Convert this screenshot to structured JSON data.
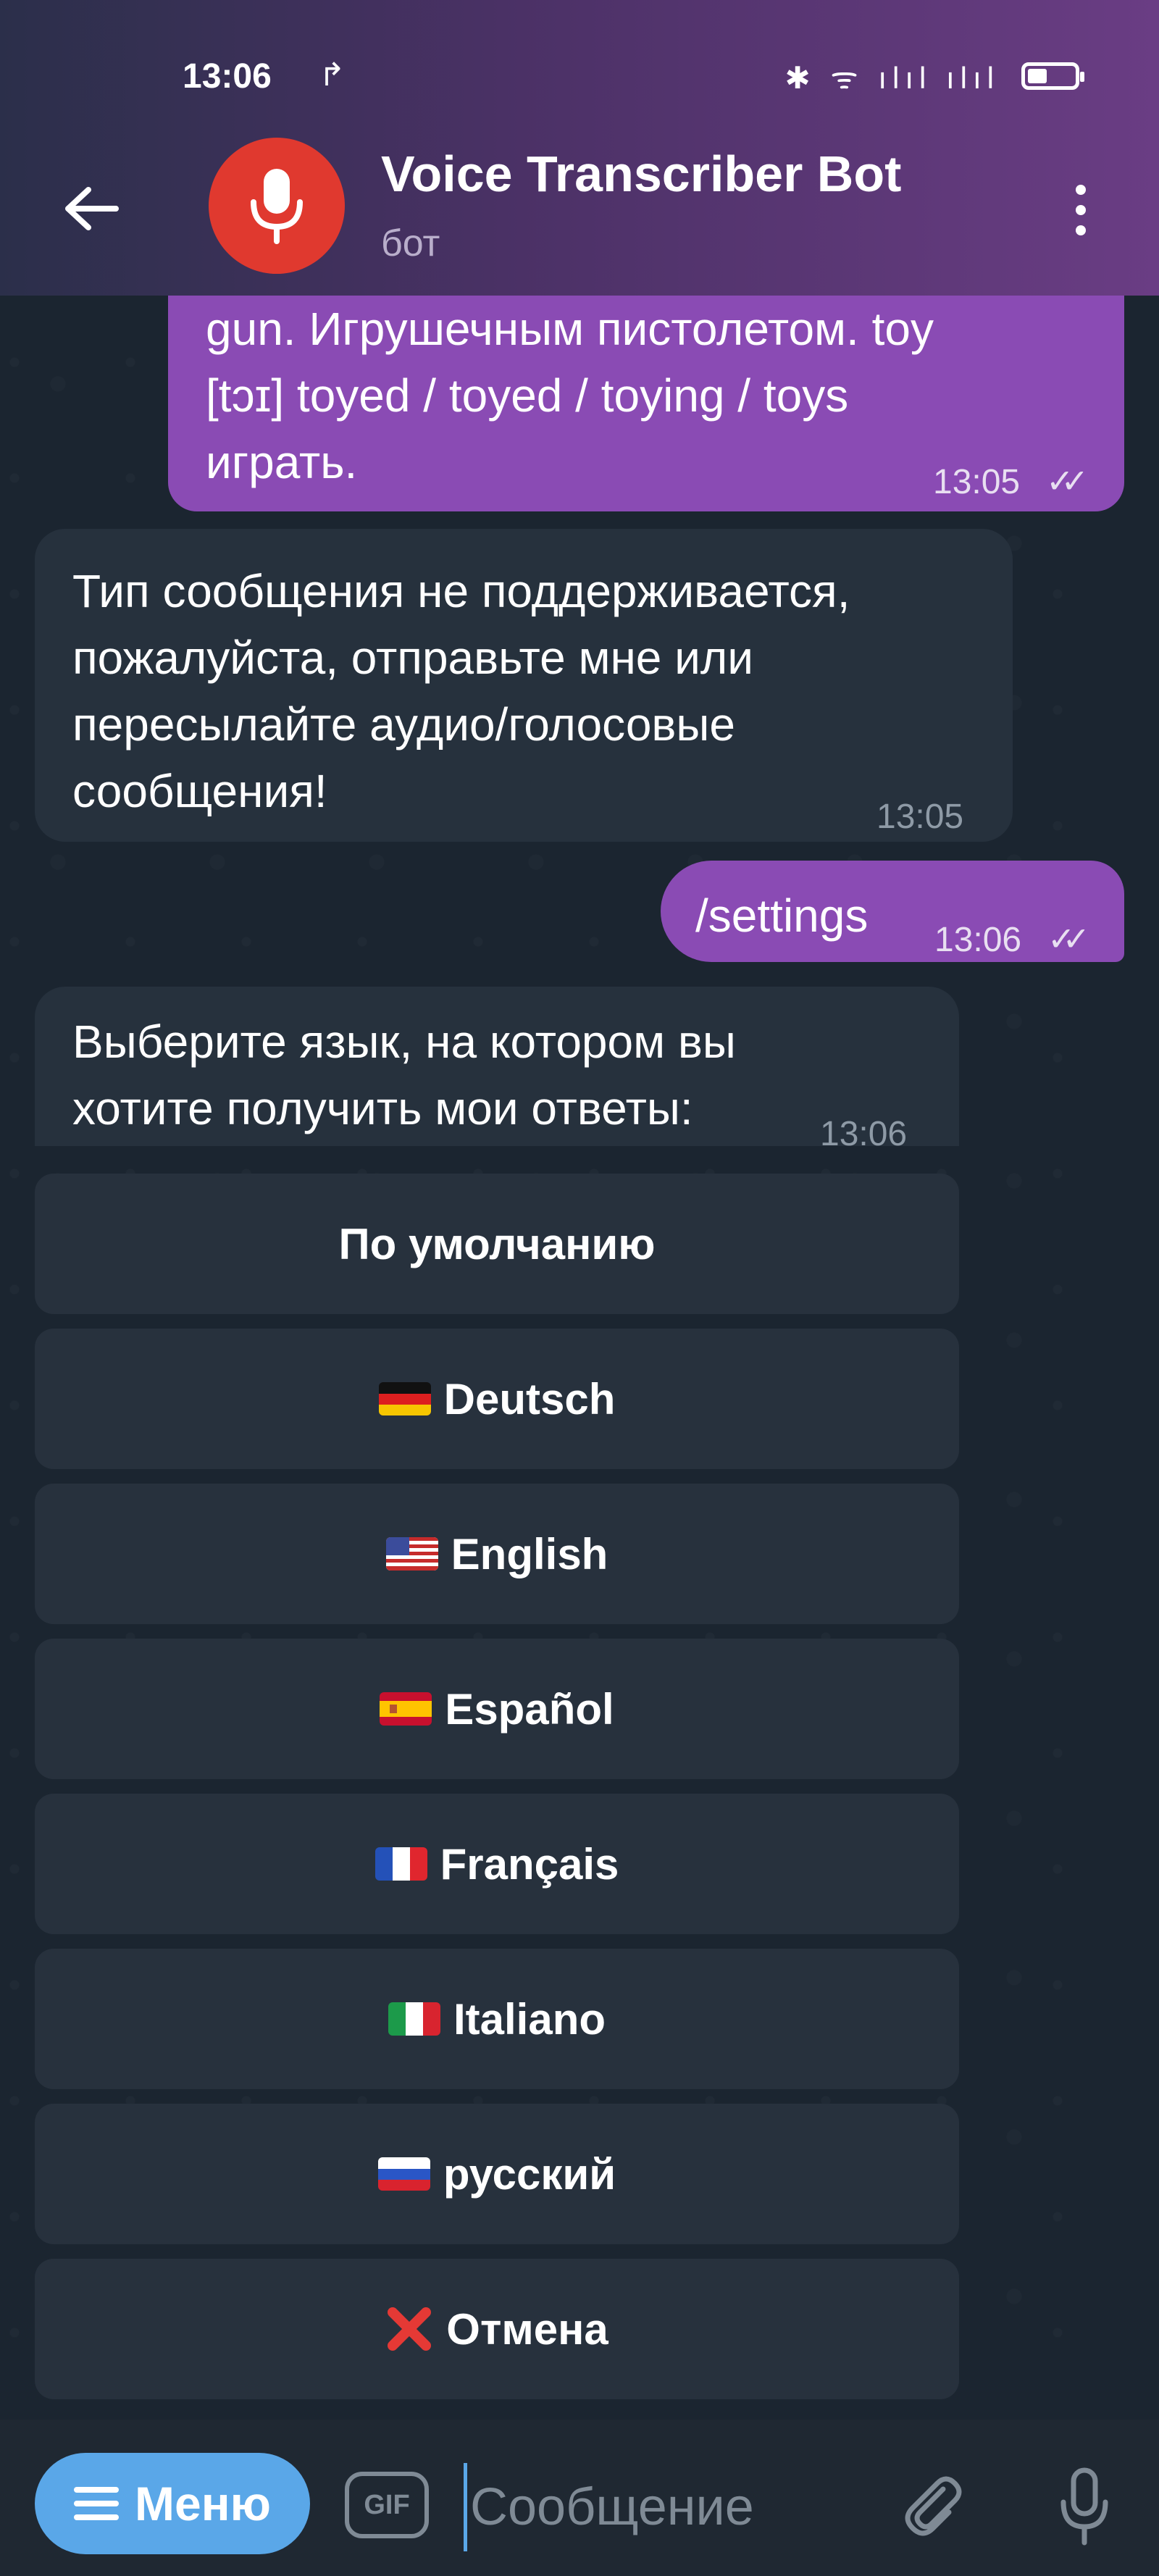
{
  "status_bar": {
    "time": "13:06",
    "extra_icon": "↱",
    "icons": "✱ ᯤ ılıl ılıl"
  },
  "header": {
    "title": "Voice Transcriber Bot",
    "subtitle": "бот"
  },
  "messages": [
    {
      "direction": "out",
      "lines": [
        "gun. Игрушечным пистолетом. toy",
        "[tɔɪ] toyed / toyed / toying / toys",
        "играть."
      ],
      "time": "13:05",
      "read": true
    },
    {
      "direction": "in",
      "lines": [
        "Тип сообщения не поддерживается,",
        "пожалуйста, отправьте мне или",
        "пересылайте аудио/голосовые",
        "сообщения!"
      ],
      "time": "13:05"
    },
    {
      "direction": "out",
      "lines": [
        "/settings"
      ],
      "time": "13:06",
      "read": true
    },
    {
      "direction": "in",
      "lines": [
        "Выберите язык, на котором вы",
        "хотите получить мои ответы:"
      ],
      "time": "13:06"
    }
  ],
  "keyboard": [
    {
      "label": "По умолчанию",
      "flag": ""
    },
    {
      "label": "Deutsch",
      "flag": "de"
    },
    {
      "label": "English",
      "flag": "us"
    },
    {
      "label": "Español",
      "flag": "es"
    },
    {
      "label": "Français",
      "flag": "fr"
    },
    {
      "label": "Italiano",
      "flag": "it"
    },
    {
      "label": "русский",
      "flag": "ru"
    },
    {
      "label": "Отмена",
      "flag": "cancel"
    }
  ],
  "bottom_bar": {
    "menu_label": "Меню",
    "gif_label": "GIF",
    "input_placeholder": "Сообщение"
  },
  "ticks": "✓✓",
  "colors": {
    "accent": "#5aa7e8",
    "outgoing_bubble": "#8a4bb4",
    "incoming_bubble": "#26313d",
    "avatar": "#e0392f",
    "cancel": "#e53935"
  }
}
